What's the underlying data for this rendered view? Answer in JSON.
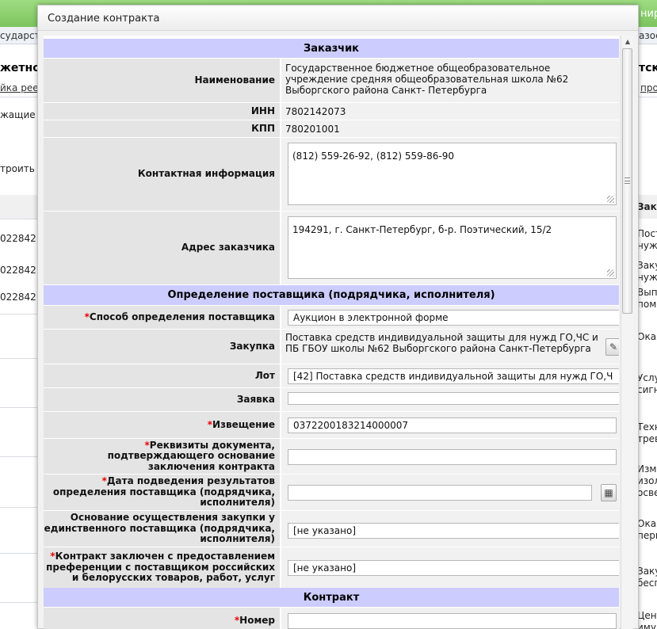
{
  "background": {
    "topbar_text_left": "",
    "topbar_text_right": "нир",
    "sub_left": "сударст",
    "sub_right": "азос",
    "title_left": "жетно",
    "title_right": "тско",
    "link_left": "йка рее",
    "link_right": "прои",
    "left_texts": [
      "жащие",
      "троить",
      "022842",
      "022842",
      "022842"
    ],
    "right_texts": [
      "Зака",
      "Пост нуж",
      "Заку нуж",
      "Выпо поме",
      "Оказ",
      "Услу сигн",
      "Техн трев",
      "Изме изол осве",
      "Оказ пери",
      "Заку бесп",
      "Цент иму"
    ]
  },
  "dialog": {
    "title": "Создание контракта"
  },
  "form": {
    "sections": {
      "customer": "Заказчик",
      "supplier": "Определение поставщика (подрядчика, исполнителя)",
      "contract": "Контракт"
    },
    "customer": {
      "name_label": "Наименование",
      "name_value": "Государственное бюджетное общеобразовательное учреждение средняя общеобразовательная школа №62 Выборгского района Санкт- Петербурга",
      "inn_label": "ИНН",
      "inn_value": "7802142073",
      "kpp_label": "КПП",
      "kpp_value": "780201001",
      "contact_label": "Контактная информация",
      "contact_value": "(812) 559-26-92, (812) 559-86-90",
      "address_label": "Адрес заказчика",
      "address_value": "194291, г. Санкт-Петербург, б-р. Поэтический, 15/2"
    },
    "supplier": {
      "method_label": "Способ определения поставщика",
      "method_value": "Аукцион в электронной форме",
      "purchase_label": "Закупка",
      "purchase_value": "Поставка средств индивидуальной защиты для нужд ГО,ЧС и ПБ ГБОУ школы №62 Выборгского района Санкт-Петербурга",
      "lot_label": "Лот",
      "lot_value": "[42] Поставка средств индивидуальной защиты для нужд ГО,Ч",
      "application_label": "Заявка",
      "application_value": "",
      "notice_label": "Извещение",
      "notice_value": "0372200183214000007",
      "docs_label": "Реквизиты документа, подтверждающего основание заключения контракта",
      "docs_value": "",
      "date_label": "Дата подведения результатов определения поставщика (подрядчика, исполнителя)",
      "date_value": "",
      "single_label": "Основание осуществления закупки у единственного поставщика (подрядчика, исполнителя)",
      "single_value": "[не указано]",
      "preference_label": "Контракт заключен с предоставлением преференции с поставщиком российских и белорусских товаров, работ, услуг",
      "preference_value": "[не указано]"
    },
    "contract": {
      "number_label": "Номер",
      "number_value": ""
    },
    "required_mark": "*"
  },
  "icons": {
    "purchase_pick": "pencil-icon",
    "calendar": "calendar-icon"
  },
  "colors": {
    "section_header": "#ccccff",
    "label_bg": "#e4e4e4",
    "value_bg": "#f1f1f1",
    "required": "#ee0000",
    "topbar": "#8fd16f"
  }
}
